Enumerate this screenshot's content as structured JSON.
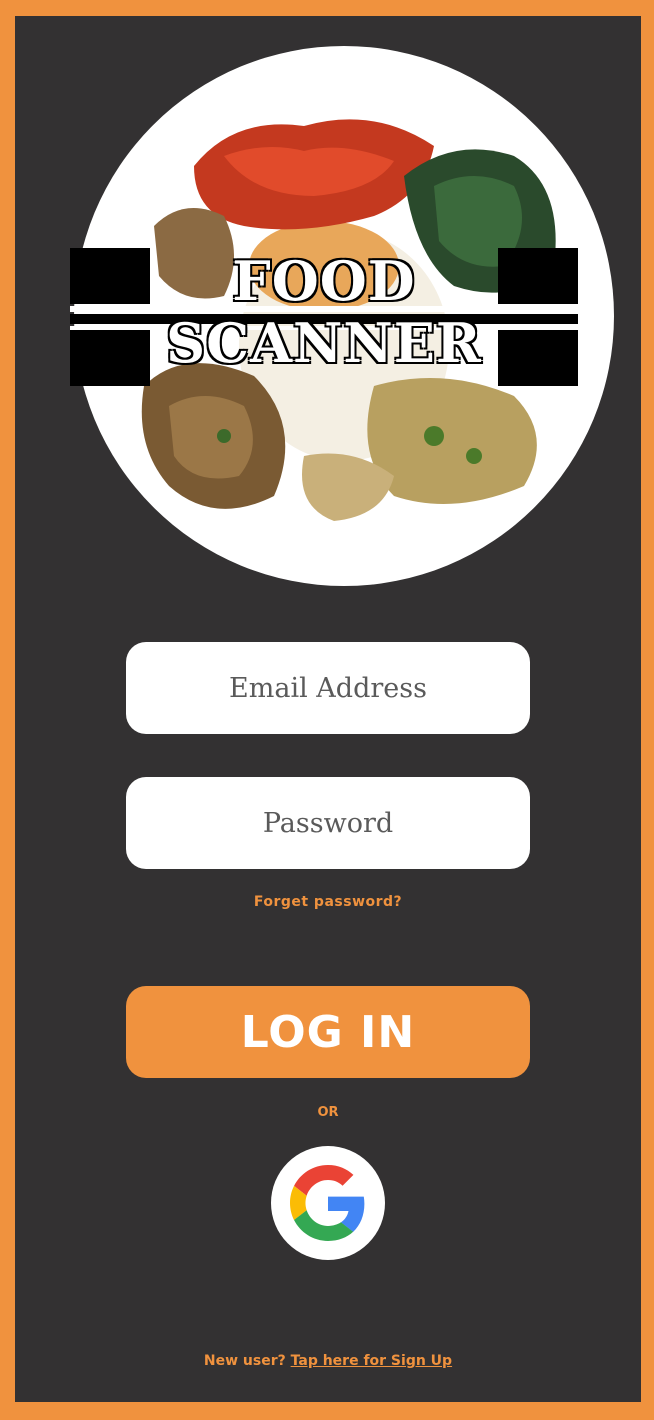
{
  "logo": {
    "line1": "FOOD",
    "line2": "SCANNER"
  },
  "login_form": {
    "email_placeholder": "Email Address",
    "password_placeholder": "Password",
    "forgot_password": "Forget password?",
    "login_button": "LOG IN",
    "separator": "OR",
    "google_button_icon": "google-icon"
  },
  "footer": {
    "prompt": "New user?",
    "signup_link": "Tap here for Sign Up"
  },
  "colors": {
    "accent": "#f0923e",
    "background": "#333132",
    "field": "#ffffff"
  },
  "icons": {
    "google": "google-icon"
  }
}
